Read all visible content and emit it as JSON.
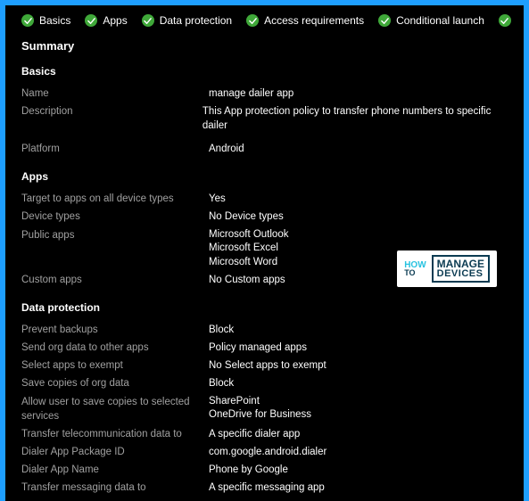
{
  "tabs": [
    {
      "label": "Basics"
    },
    {
      "label": "Apps"
    },
    {
      "label": "Data protection"
    },
    {
      "label": "Access requirements"
    },
    {
      "label": "Conditional launch"
    }
  ],
  "summary_title": "Summary",
  "sections": {
    "basics": {
      "title": "Basics",
      "name_label": "Name",
      "name_value": "manage dailer app",
      "description_label": "Description",
      "description_value": "This App protection policy to transfer phone numbers to specific dailer",
      "platform_label": "Platform",
      "platform_value": "Android"
    },
    "apps": {
      "title": "Apps",
      "target_label": "Target to apps on all device types",
      "target_value": "Yes",
      "device_types_label": "Device types",
      "device_types_value": "No Device types",
      "public_apps_label": "Public apps",
      "public_apps_values": [
        "Microsoft Outlook",
        "Microsoft Excel",
        "Microsoft Word"
      ],
      "custom_apps_label": "Custom apps",
      "custom_apps_value": "No Custom apps"
    },
    "data_protection": {
      "title": "Data protection",
      "prevent_backups_label": "Prevent backups",
      "prevent_backups_value": "Block",
      "send_org_label": "Send org data to other apps",
      "send_org_value": "Policy managed apps",
      "select_exempt_label": "Select apps to exempt",
      "select_exempt_value": "No Select apps to exempt",
      "save_copies_label": "Save copies of org data",
      "save_copies_value": "Block",
      "allow_save_label": "Allow user to save copies to selected services",
      "allow_save_values": [
        "SharePoint",
        "OneDrive for Business"
      ],
      "telecom_label": "Transfer telecommunication data to",
      "telecom_value": "A specific dialer app",
      "dialer_pkg_label": "Dialer App Package ID",
      "dialer_pkg_value": "com.google.android.dialer",
      "dialer_name_label": "Dialer App Name",
      "dialer_name_value": "Phone by Google",
      "messaging_label": "Transfer messaging data to",
      "messaging_value": "A specific messaging app"
    }
  },
  "branding": {
    "how": "HOW",
    "to": "TO",
    "manage": "MANAGE",
    "devices": "DEVICES"
  }
}
